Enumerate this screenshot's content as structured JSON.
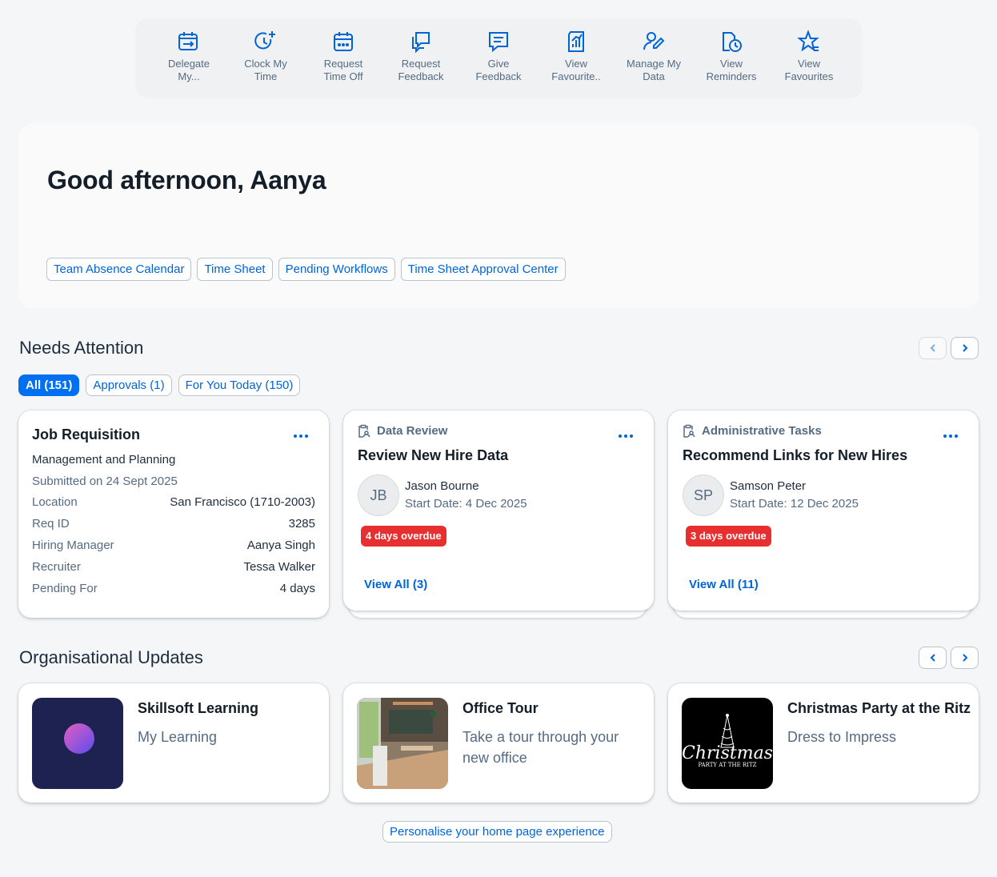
{
  "quick_actions": [
    {
      "label": "Delegate\nMy...",
      "icon": "calendar-delegate-icon"
    },
    {
      "label": "Clock My\nTime",
      "icon": "clock-add-icon"
    },
    {
      "label": "Request\nTime Off",
      "icon": "calendar-request-icon"
    },
    {
      "label": "Request\nFeedback",
      "icon": "feedback-request-icon"
    },
    {
      "label": "Give\nFeedback",
      "icon": "feedback-give-icon"
    },
    {
      "label": "View\nFavourite..",
      "icon": "report-icon"
    },
    {
      "label": "Manage My\nData",
      "icon": "user-edit-icon"
    },
    {
      "label": "View\nReminders",
      "icon": "reminder-icon"
    },
    {
      "label": "View\nFavourites",
      "icon": "star-list-icon"
    }
  ],
  "greeting": {
    "title": "Good afternoon, Aanya",
    "links": [
      "Team Absence Calendar",
      "Time Sheet",
      "Pending Workflows",
      "Time Sheet Approval Center"
    ]
  },
  "needs_attention": {
    "title": "Needs Attention",
    "filters": [
      {
        "label": "All (151)",
        "active": true
      },
      {
        "label": "Approvals (1)",
        "active": false
      },
      {
        "label": "For You Today (150)",
        "active": false
      }
    ],
    "job_requisition": {
      "title": "Job Requisition",
      "subtitle": "Management and Planning",
      "submitted": "Submitted on 24 Sept 2025",
      "rows": [
        {
          "key": "Location",
          "value": "San Francisco (1710-2003)"
        },
        {
          "key": "Req ID",
          "value": "3285"
        },
        {
          "key": "Hiring Manager",
          "value": "Aanya Singh"
        },
        {
          "key": "Recruiter",
          "value": "Tessa Walker"
        },
        {
          "key": "Pending For",
          "value": "4 days"
        }
      ]
    },
    "tasks": [
      {
        "category": "Data Review",
        "title": "Review New Hire Data",
        "initials": "JB",
        "name": "Jason Bourne",
        "date": "Start Date: 4 Dec 2025",
        "overdue": "4 days overdue",
        "view_all": "View All (3)"
      },
      {
        "category": "Administrative Tasks",
        "title": "Recommend Links for New Hires",
        "initials": "SP",
        "name": "Samson Peter",
        "date": "Start Date: 12 Dec 2025",
        "overdue": "3 days overdue",
        "view_all": "View All (11)"
      }
    ]
  },
  "org_updates": {
    "title": "Organisational Updates",
    "items": [
      {
        "title": "Skillsoft Learning",
        "desc": "My Learning"
      },
      {
        "title": "Office Tour",
        "desc": "Take a tour through your new office"
      },
      {
        "title": "Christmas Party at the Ritz",
        "desc": "Dress to Impress",
        "image_text": "Christmas",
        "image_subtext": "PARTY AT THE RITZ"
      }
    ]
  },
  "personalise_label": "Personalise your home page experience",
  "colors": {
    "accent": "#0064d9",
    "overdue": "#e82f2f",
    "active_chip": "#0070f2"
  }
}
